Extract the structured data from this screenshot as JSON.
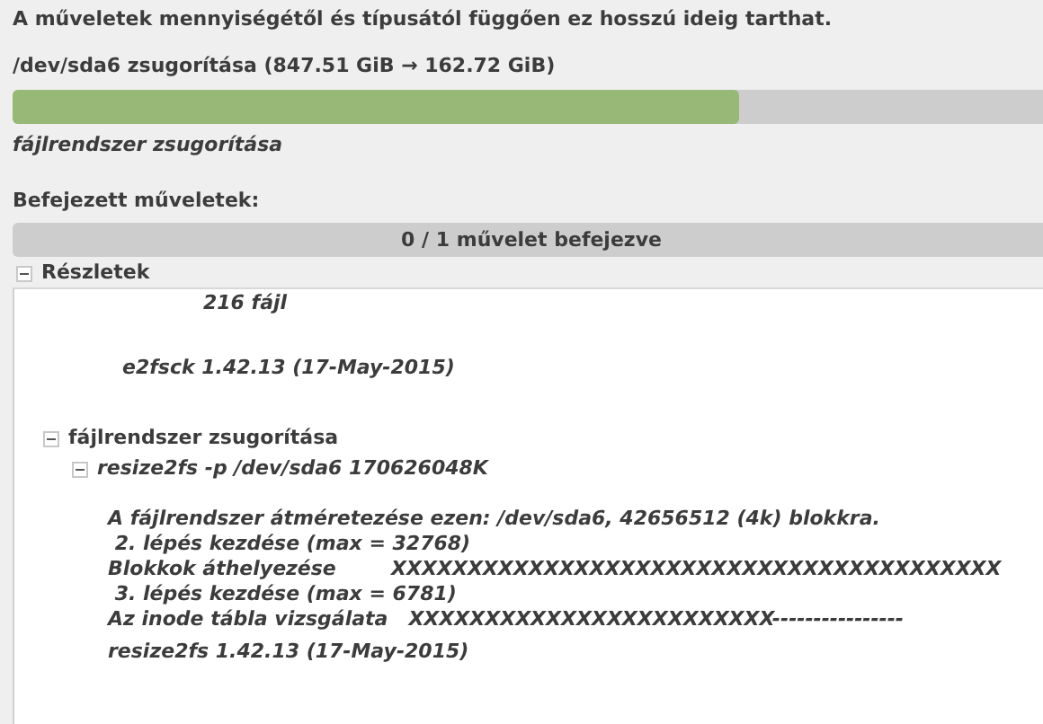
{
  "notice": "A műveletek mennyiségétől és típusától függően ez hosszú ideig tarthat.",
  "current_operation": {
    "title": "/dev/sda6 zsugorítása (847.51 GiB → 162.72 GiB)",
    "level": 0.7,
    "step": "fájlrendszer zsugorítása"
  },
  "completed": {
    "label": "Befejezett műveletek:",
    "reading": "0 / 1 művelet befejezve"
  },
  "details": {
    "label": "Részletek",
    "expanded": true,
    "children": [
      {
        "kind": "output",
        "lines": [
          "216 fájl"
        ]
      },
      {
        "kind": "output",
        "lines": [
          "e2fsck 1.42.13 (17-May-2015)"
        ]
      },
      {
        "kind": "node",
        "label": "fájlrendszer zsugorítása",
        "expanded": true,
        "children": [
          {
            "kind": "command",
            "label": "resize2fs -p /dev/sda6 170626048K",
            "expanded": true,
            "children": [
              {
                "kind": "output",
                "lines": [
                  "A fájlrendszer átméretezése ezen: /dev/sda6, 42656512 (4k) blokkra.",
                  " 2. lépés kezdése (max = 32768)",
                  "Blokkok áthelyezése        XXXXXXXXXXXXXXXXXXXXXXXXXXXXXXXXXXXXXXXX",
                  " 3. lépés kezdése (max = 6781)",
                  "Az inode tábla vizsgálata   XXXXXXXXXXXXXXXXXXXXXXXX----------------"
                ]
              },
              {
                "kind": "output",
                "lines": [
                  "resize2fs 1.42.13 (17-May-2015)"
                ]
              }
            ]
          }
        ]
      }
    ]
  }
}
